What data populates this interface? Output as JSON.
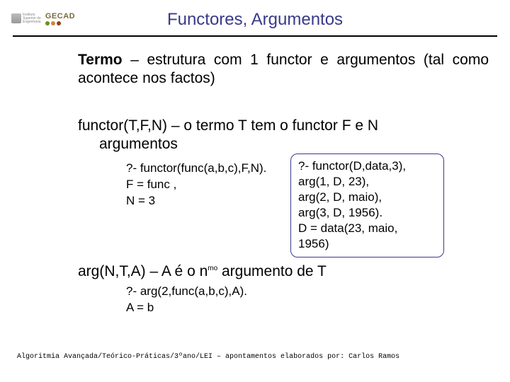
{
  "header": {
    "title": "Functores, Argumentos",
    "logo_alt_left": "ISEP",
    "logo_alt_right": "GECAD"
  },
  "body": {
    "termo_bold": "Termo",
    "termo_rest": " – estrutura com 1 functor e argumentos (tal como acontece nos factos)",
    "functor_line1": "functor(T,F,N) – o termo T tem o functor F e N",
    "functor_line2": "argumentos",
    "example_left": {
      "l1": "?- functor(func(a,b,c),F,N).",
      "l2": "F = func ,",
      "l3": "N = 3"
    },
    "box": {
      "l1": "?- functor(D,data,3),",
      "l2": "arg(1, D, 23),",
      "l3": "arg(2, D, maio),",
      "l4": "arg(3, D, 1956).",
      "l5": "D = data(23, maio,",
      "l6": "1956)"
    },
    "arg_line_pre": "arg(N,T,A) – A é o n",
    "arg_line_sup": "mo",
    "arg_line_post": " argumento de T",
    "example_bottom": {
      "l1": "?- arg(2,func(a,b,c),A).",
      "l2": "A = b"
    }
  },
  "footer": {
    "text": "Algoritmia Avançada/Teórico-Práticas/3ºano/LEI – apontamentos elaborados por: Carlos Ramos"
  }
}
